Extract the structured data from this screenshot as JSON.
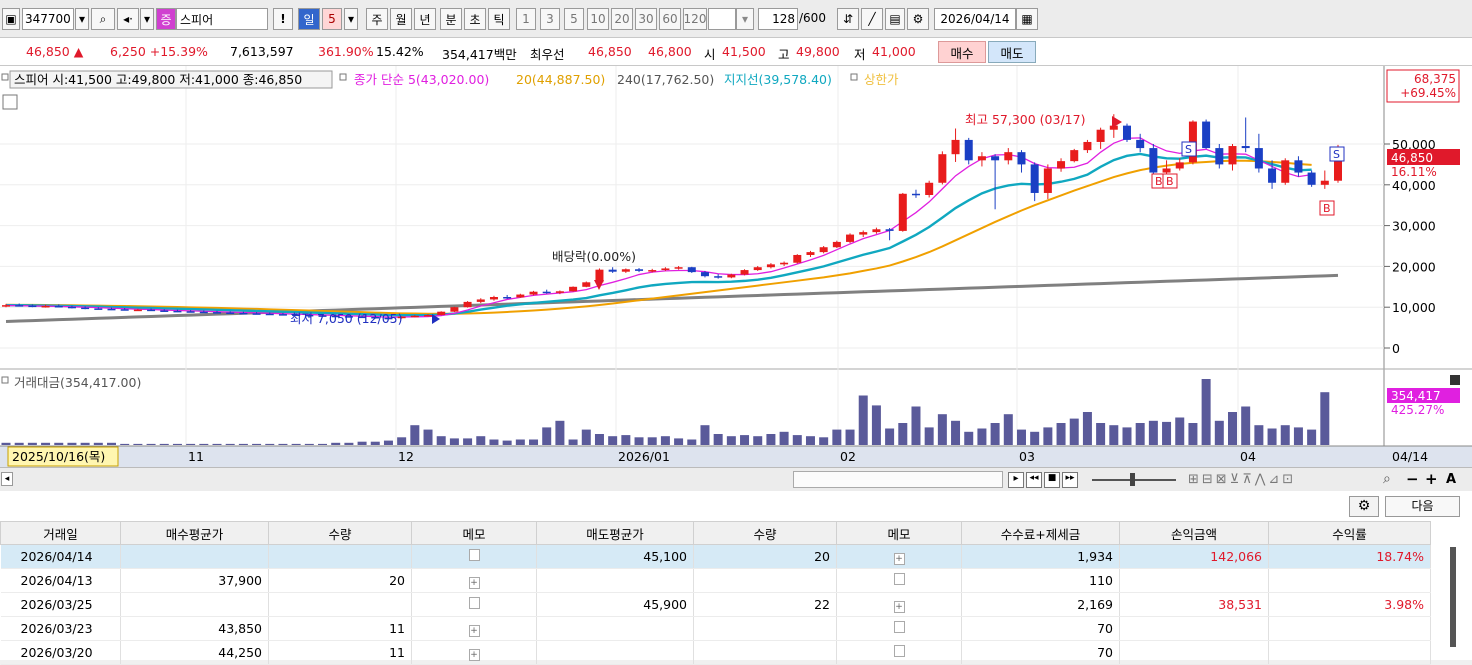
{
  "toolbar": {
    "code": "347700",
    "market": "증",
    "name": "스피어",
    "periods": [
      "일",
      "5",
      "주",
      "월",
      "년",
      "분",
      "초",
      "틱"
    ],
    "minutes": [
      "1",
      "3",
      "5",
      "10",
      "20",
      "30",
      "60",
      "120"
    ],
    "count": "128",
    "count_total": "/600",
    "date": "2026/04/14",
    "excl": "!"
  },
  "info": {
    "price": "46,850 ▲",
    "change": "6,250 +15.39%",
    "volume": "7,613,597",
    "vol_ratio": "361.90%",
    "turnover": "15.42%",
    "amount": "354,417백만",
    "best_bid_label": "최우선",
    "ask": "46,850",
    "bid": "46,800",
    "open_label": "시",
    "open": "41,500",
    "high_label": "고",
    "high": "49,800",
    "low_label": "저",
    "low": "41,000",
    "buy_btn": "매수",
    "sell_btn": "매도"
  },
  "legend": {
    "main": "스피어 시:41,500 고:49,800 저:41,000 종:46,850",
    "ma5": "종가 단순 5(43,020.00)",
    "ma20": "20(44,887.50)",
    "ma240": "240(17,762.50)",
    "support": "지지선(39,578.40)",
    "upper": "상한가",
    "volume": "거래대금(354,417.00)"
  },
  "annotations": {
    "high": "최고 57,300 (03/17)",
    "low": "최저 7,050 (12/05)",
    "dividend": "배당락(0.00%)"
  },
  "right_labels": {
    "upper_price": "68,375",
    "upper_pct": "+69.45%",
    "last_price": "46,850",
    "last_pct": "16.11%",
    "vol_value": "354,417",
    "vol_pct": "425.27%"
  },
  "x_labels": {
    "start": "2025/10/16(목)",
    "m11": "11",
    "m12": "12",
    "m01": "2026/01",
    "m02": "02",
    "m03": "03",
    "m04": "04",
    "end": "04/14"
  },
  "grid_controls": {
    "next": "다음"
  },
  "colors": {
    "up": "#e81c1c",
    "down": "#1a3fc4",
    "ma5": "#e020e0",
    "ma20": "#f0a000",
    "ma60": "#10a8c0",
    "ma240": "#808080",
    "vol": "#5a5a9a"
  },
  "chart_data": {
    "type": "candlestick",
    "y_axis": {
      "ticks": [
        "50,000",
        "40,000",
        "30,000",
        "20,000",
        "10,000",
        "0"
      ],
      "range": [
        0,
        65000
      ]
    },
    "candles": [
      [
        10300,
        10800,
        10000,
        10500
      ],
      [
        10500,
        10900,
        10200,
        10400
      ],
      [
        10400,
        10700,
        10000,
        10200
      ],
      [
        10200,
        10600,
        9900,
        10300
      ],
      [
        10300,
        10700,
        10000,
        10100
      ],
      [
        10100,
        10400,
        9700,
        9900
      ],
      [
        9900,
        10200,
        9500,
        9700
      ],
      [
        9700,
        10000,
        9400,
        9600
      ],
      [
        9600,
        9900,
        9300,
        9500
      ],
      [
        9500,
        9800,
        9200,
        9300
      ],
      [
        9300,
        9600,
        9100,
        9400
      ],
      [
        9400,
        9700,
        9100,
        9200
      ],
      [
        9200,
        9500,
        8900,
        9100
      ],
      [
        9100,
        9400,
        8800,
        9000
      ],
      [
        9000,
        9300,
        8700,
        8900
      ],
      [
        8900,
        9200,
        8600,
        8800
      ],
      [
        8800,
        9100,
        8500,
        8700
      ],
      [
        8700,
        9000,
        8400,
        8600
      ],
      [
        8600,
        8900,
        8300,
        8500
      ],
      [
        8500,
        8800,
        8200,
        8400
      ],
      [
        8400,
        8700,
        8100,
        8300
      ],
      [
        8300,
        8600,
        8000,
        8200
      ],
      [
        8200,
        8500,
        7900,
        8100
      ],
      [
        8100,
        8400,
        7800,
        8000
      ],
      [
        8000,
        8300,
        7700,
        7900
      ],
      [
        7900,
        8200,
        7600,
        7800
      ],
      [
        7800,
        8100,
        7500,
        7700
      ],
      [
        7700,
        8000,
        7400,
        7600
      ],
      [
        7600,
        7900,
        7200,
        7400
      ],
      [
        7400,
        7700,
        7050,
        7300
      ],
      [
        7300,
        7800,
        7200,
        7700
      ],
      [
        7700,
        8100,
        7500,
        7900
      ],
      [
        7900,
        8300,
        7700,
        8100
      ],
      [
        8100,
        9000,
        8000,
        8900
      ],
      [
        8900,
        10100,
        8800,
        10000
      ],
      [
        10000,
        11500,
        9900,
        11300
      ],
      [
        11300,
        12200,
        11000,
        11900
      ],
      [
        11900,
        12800,
        11600,
        12500
      ],
      [
        12500,
        13000,
        12000,
        12400
      ],
      [
        12400,
        13300,
        12300,
        13100
      ],
      [
        13100,
        14000,
        12900,
        13800
      ],
      [
        13800,
        14300,
        13300,
        13600
      ],
      [
        13600,
        14100,
        13200,
        13900
      ],
      [
        13900,
        15100,
        13800,
        15000
      ],
      [
        15000,
        16300,
        14900,
        16100
      ],
      [
        16100,
        19500,
        16000,
        19200
      ],
      [
        19200,
        19800,
        18400,
        18700
      ],
      [
        18700,
        19500,
        18400,
        19300
      ],
      [
        19300,
        19600,
        18600,
        18900
      ],
      [
        18900,
        19400,
        18500,
        19100
      ],
      [
        19100,
        19800,
        18900,
        19500
      ],
      [
        19500,
        20100,
        19200,
        19800
      ],
      [
        19800,
        19900,
        18400,
        18600
      ],
      [
        18600,
        18900,
        17300,
        17600
      ],
      [
        17600,
        18100,
        17000,
        17300
      ],
      [
        17300,
        18200,
        17100,
        18000
      ],
      [
        18000,
        19300,
        17800,
        19100
      ],
      [
        19100,
        20100,
        18900,
        19800
      ],
      [
        19800,
        20800,
        19500,
        20500
      ],
      [
        20500,
        21200,
        20100,
        20900
      ],
      [
        20900,
        23000,
        20700,
        22800
      ],
      [
        22800,
        23800,
        22300,
        23500
      ],
      [
        23500,
        25000,
        23200,
        24700
      ],
      [
        24700,
        26300,
        24500,
        26000
      ],
      [
        26000,
        28100,
        25700,
        27800
      ],
      [
        27800,
        28800,
        27200,
        28400
      ],
      [
        28400,
        29500,
        28000,
        29100
      ],
      [
        29100,
        29400,
        26400,
        28700
      ],
      [
        28700,
        38000,
        28500,
        37800
      ],
      [
        37800,
        38800,
        36800,
        37500
      ],
      [
        37500,
        41000,
        36900,
        40500
      ],
      [
        40500,
        48200,
        40100,
        47500
      ],
      [
        47500,
        53800,
        45600,
        51000
      ],
      [
        51000,
        51500,
        45000,
        46000
      ],
      [
        46000,
        48000,
        44500,
        47000
      ],
      [
        47000,
        47500,
        34000,
        46000
      ],
      [
        46000,
        49000,
        45000,
        48000
      ],
      [
        48000,
        48500,
        43000,
        45000
      ],
      [
        45000,
        45500,
        36000,
        38000
      ],
      [
        38000,
        45000,
        36500,
        44000
      ],
      [
        44000,
        46500,
        43200,
        45800
      ],
      [
        45800,
        48800,
        45500,
        48500
      ],
      [
        48500,
        51000,
        47800,
        50500
      ],
      [
        50500,
        54000,
        48800,
        53500
      ],
      [
        53500,
        57300,
        51500,
        54500
      ],
      [
        54500,
        55000,
        50500,
        51000
      ],
      [
        51000,
        52500,
        48000,
        49000
      ],
      [
        49000,
        50000,
        42500,
        43000
      ],
      [
        43000,
        46000,
        42000,
        44000
      ],
      [
        44000,
        46500,
        43500,
        45500
      ],
      [
        45500,
        55800,
        45000,
        55500
      ],
      [
        55500,
        56000,
        48800,
        49000
      ],
      [
        49000,
        50000,
        44000,
        45000
      ],
      [
        45000,
        50000,
        43500,
        49500
      ],
      [
        49500,
        56500,
        48000,
        49000
      ],
      [
        49000,
        52500,
        43000,
        44000
      ],
      [
        44000,
        46000,
        39000,
        40500
      ],
      [
        40500,
        46500,
        40000,
        46000
      ],
      [
        46000,
        47000,
        42000,
        43000
      ],
      [
        43000,
        43500,
        39500,
        40000
      ],
      [
        40000,
        43500,
        39000,
        41000
      ],
      [
        41000,
        49800,
        40500,
        46850
      ]
    ],
    "ma5": [
      10400,
      10400,
      10300,
      10250,
      10200,
      10100,
      10000,
      9900,
      9750,
      9650,
      9500,
      9450,
      9300,
      9200,
      9100,
      9000,
      8900,
      8800,
      8700,
      8600,
      8500,
      8400,
      8300,
      8200,
      8100,
      8000,
      7900,
      7800,
      7700,
      7550,
      7600,
      7650,
      7700,
      7950,
      8500,
      9300,
      10300,
      11100,
      11900,
      12400,
      12900,
      13200,
      13500,
      13800,
      14300,
      15300,
      16100,
      17000,
      18000,
      18600,
      18900,
      19000,
      19000,
      18700,
      18200,
      18000,
      18000,
      18200,
      18700,
      19600,
      20600,
      21600,
      22700,
      24100,
      25500,
      26800,
      27800,
      28800,
      31000,
      33200,
      35800,
      39000,
      42200,
      44500,
      46400,
      47300,
      47400,
      46800,
      45200,
      44200,
      44100,
      44300,
      45300,
      48000,
      50200,
      51400,
      51500,
      49700,
      48300,
      47700,
      48300,
      48700,
      47500,
      47600,
      47500,
      46000,
      44500,
      43000,
      42000,
      42500
    ],
    "ma20": [
      10600,
      10580,
      10560,
      10530,
      10500,
      10470,
      10430,
      10390,
      10340,
      10290,
      10230,
      10170,
      10110,
      10040,
      9970,
      9900,
      9820,
      9740,
      9660,
      9580,
      9480,
      9380,
      9280,
      9180,
      9080,
      8980,
      8880,
      8780,
      8680,
      8580,
      8500,
      8450,
      8400,
      8380,
      8400,
      8450,
      8550,
      8680,
      8830,
      9000,
      9200,
      9420,
      9660,
      9920,
      10200,
      10550,
      10900,
      11300,
      11700,
      12100,
      12500,
      12900,
      13300,
      13700,
      14100,
      14500,
      14900,
      15300,
      15700,
      16100,
      16500,
      16900,
      17300,
      17800,
      18300,
      18900,
      19500,
      20200,
      21200,
      22300,
      23500,
      24900,
      26400,
      27900,
      29400,
      30900,
      32300,
      33700,
      35000,
      36200,
      37400,
      38600,
      39700,
      40800,
      41900,
      42800,
      43600,
      44200,
      44700,
      45100,
      45400,
      45600,
      45800,
      45900,
      45900,
      45800,
      45600,
      45400,
      45100,
      44887
    ]
  },
  "volume_data": {
    "values": [
      2,
      2,
      2,
      2,
      2,
      2,
      2,
      2,
      2,
      1,
      1,
      1,
      1,
      1,
      1,
      1,
      1,
      1,
      1,
      1,
      1,
      1,
      1,
      1,
      1,
      2,
      2,
      3,
      3,
      4,
      7,
      18,
      14,
      8,
      6,
      6,
      8,
      5,
      4,
      5,
      5,
      16,
      22,
      5,
      14,
      10,
      8,
      9,
      7,
      7,
      8,
      6,
      5,
      18,
      10,
      8,
      9,
      8,
      10,
      12,
      9,
      8,
      7,
      14,
      14,
      45,
      36,
      15,
      20,
      35,
      16,
      28,
      22,
      12,
      15,
      20,
      28,
      14,
      12,
      16,
      20,
      24,
      30,
      20,
      18,
      16,
      20,
      22,
      21,
      25,
      20,
      60,
      22,
      30,
      35,
      18,
      15,
      18,
      16,
      14,
      48
    ]
  },
  "table": {
    "headers": [
      "거래일",
      "매수평균가",
      "수량",
      "메모",
      "매도평균가",
      "수량",
      "메모",
      "수수료+제세금",
      "손익금액",
      "수익률"
    ],
    "rows": [
      [
        "2026/04/14",
        "",
        "",
        "",
        "45,100",
        "20",
        "",
        "1,934",
        "142,066",
        "18.74%"
      ],
      [
        "2026/04/13",
        "37,900",
        "20",
        "",
        "",
        "",
        "",
        "110",
        "",
        ""
      ],
      [
        "2026/03/25",
        "",
        "",
        "",
        "45,900",
        "22",
        "",
        "2,169",
        "38,531",
        "3.98%"
      ],
      [
        "2026/03/23",
        "43,850",
        "11",
        "",
        "",
        "",
        "",
        "70",
        "",
        ""
      ],
      [
        "2026/03/20",
        "44,250",
        "11",
        "",
        "",
        "",
        "",
        "70",
        "",
        ""
      ]
    ]
  }
}
